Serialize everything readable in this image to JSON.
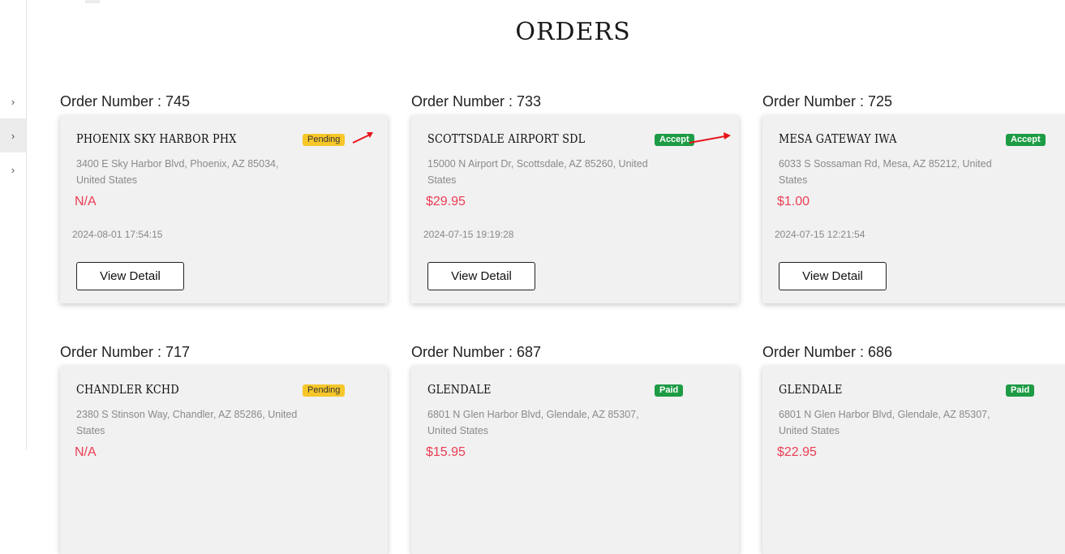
{
  "page": {
    "title": "ORDERS"
  },
  "sidebar": {
    "items": [
      {
        "icon": "chevron-right-icon",
        "glyph": "›"
      },
      {
        "icon": "chevron-right-icon",
        "glyph": "›"
      },
      {
        "icon": "chevron-right-icon",
        "glyph": "›"
      }
    ]
  },
  "orders": [
    {
      "number_label": "Order Number : 745",
      "location": "PHOENIX SKY HARBOR PHX",
      "status": "Pending",
      "address": "3400 E Sky Harbor Blvd, Phoenix, AZ 85034, United States",
      "price": "N/A",
      "datetime": "2024-08-01 17:54:15",
      "button": "View Detail"
    },
    {
      "number_label": "Order Number : 733",
      "location": "SCOTTSDALE AIRPORT SDL",
      "status": "Accept",
      "address": "15000 N Airport Dr, Scottsdale, AZ 85260, United States",
      "price": "$29.95",
      "datetime": "2024-07-15 19:19:28",
      "button": "View Detail"
    },
    {
      "number_label": "Order Number : 725",
      "location": "MESA GATEWAY IWA",
      "status": "Accept",
      "address": "6033 S Sossaman Rd, Mesa, AZ 85212, United States",
      "price": "$1.00",
      "datetime": "2024-07-15 12:21:54",
      "button": "View Detail"
    },
    {
      "number_label": "Order Number : 717",
      "location": "CHANDLER KCHD",
      "status": "Pending",
      "address": "2380 S Stinson Way, Chandler, AZ 85286, United States",
      "price": "N/A",
      "datetime": "",
      "button": ""
    },
    {
      "number_label": "Order Number : 687",
      "location": "GLENDALE",
      "status": "Paid",
      "address": "6801 N Glen Harbor Blvd, Glendale, AZ 85307, United States",
      "price": "$15.95",
      "datetime": "",
      "button": ""
    },
    {
      "number_label": "Order Number : 686",
      "location": "GLENDALE",
      "status": "Paid",
      "address": "6801 N Glen Harbor Blvd, Glendale, AZ 85307, United States",
      "price": "$22.95",
      "datetime": "",
      "button": ""
    }
  ],
  "colors": {
    "pending": "#f7c72a",
    "accept": "#1e9b45",
    "paid": "#1e9b45",
    "price": "#ec3d54",
    "annotation_arrow": "#e8141b"
  }
}
